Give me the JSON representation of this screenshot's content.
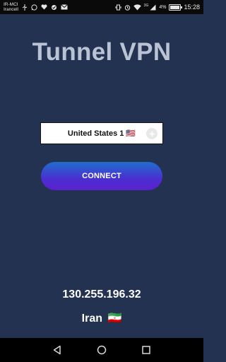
{
  "status_bar": {
    "carrier_line1": "IR-MCI",
    "carrier_line2": "Irancell",
    "battery_percent": "4%",
    "network_label": "3G",
    "time": "15:28",
    "icons": [
      "usb-icon",
      "whatsapp-icon",
      "heart-icon",
      "vpn-icon",
      "mail-icon",
      "vibrate-icon",
      "alarm-icon",
      "wifi-icon",
      "signal-icon",
      "battery-charging-icon"
    ]
  },
  "app": {
    "title": "Tunnel VPN"
  },
  "server": {
    "selected_name": "United States 1",
    "selected_flag": "🇺🇸",
    "action_icon": "plus-icon"
  },
  "connect": {
    "label": "CONNECT",
    "gradient_top": "#1f6fcc",
    "gradient_bottom": "#5a22cf"
  },
  "connection_info": {
    "ip": "130.255.196.32",
    "country": "Iran",
    "country_flag": "🇮🇷"
  },
  "nav_bar": {
    "buttons": [
      "back-icon",
      "home-icon",
      "recents-icon"
    ]
  },
  "colors": {
    "background": "#233250",
    "title": "#b9c3d4"
  }
}
